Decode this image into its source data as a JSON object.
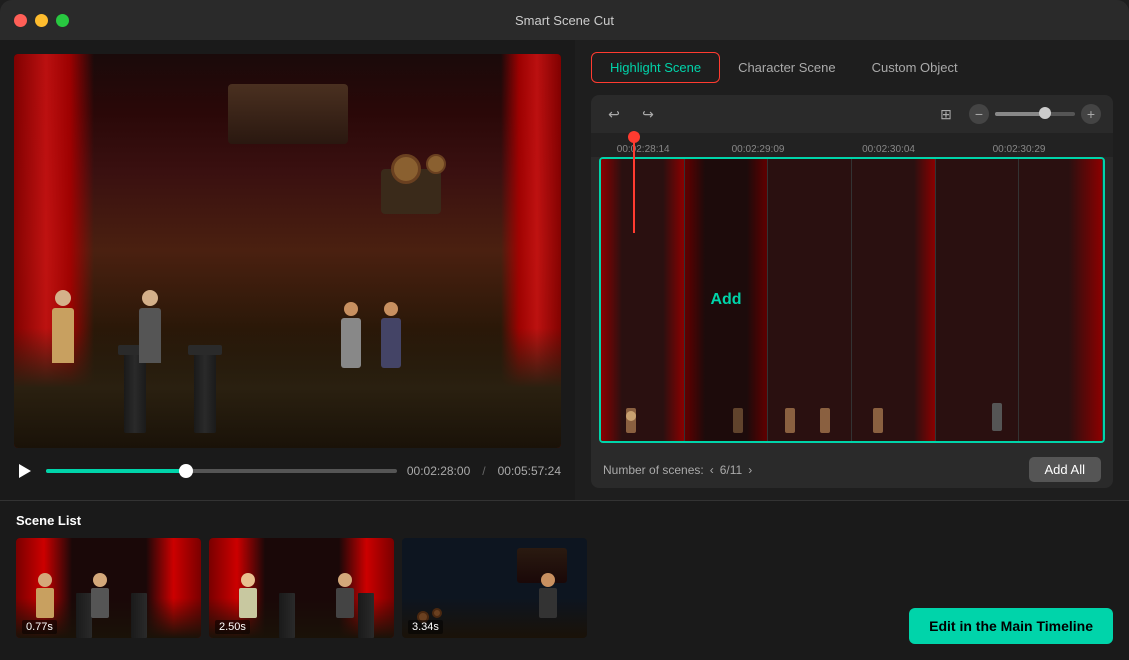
{
  "app": {
    "title": "Smart Scene Cut"
  },
  "titlebar": {
    "buttons": {
      "close": "●",
      "minimize": "●",
      "maximize": "●"
    }
  },
  "tabs": {
    "items": [
      {
        "id": "highlight",
        "label": "Highlight Scene",
        "active": true
      },
      {
        "id": "character",
        "label": "Character Scene",
        "active": false
      },
      {
        "id": "custom",
        "label": "Custom Object",
        "active": false
      }
    ]
  },
  "video": {
    "current_time": "00:02:28:00",
    "total_time": "00:05:57:24",
    "progress_percent": 40
  },
  "timeline": {
    "markers": [
      {
        "time": "00:02:28:14",
        "pos": 10
      },
      {
        "time": "00:02:29:09",
        "pos": 32
      },
      {
        "time": "00:02:30:04",
        "pos": 58
      },
      {
        "time": "00:02:30:29",
        "pos": 83
      }
    ],
    "add_label": "Add",
    "scenes_label": "Number of scenes:",
    "scenes_current": 6,
    "scenes_total": 11,
    "add_all_label": "Add All"
  },
  "scene_list": {
    "title": "Scene List",
    "items": [
      {
        "duration": "0.77s"
      },
      {
        "duration": "2.50s"
      },
      {
        "duration": "3.34s"
      }
    ]
  },
  "actions": {
    "edit_timeline": "Edit in the Main Timeline"
  },
  "icons": {
    "play": "▶",
    "undo": "↩",
    "redo": "↪",
    "add_clip": "⊞",
    "minus": "−",
    "plus": "+"
  }
}
